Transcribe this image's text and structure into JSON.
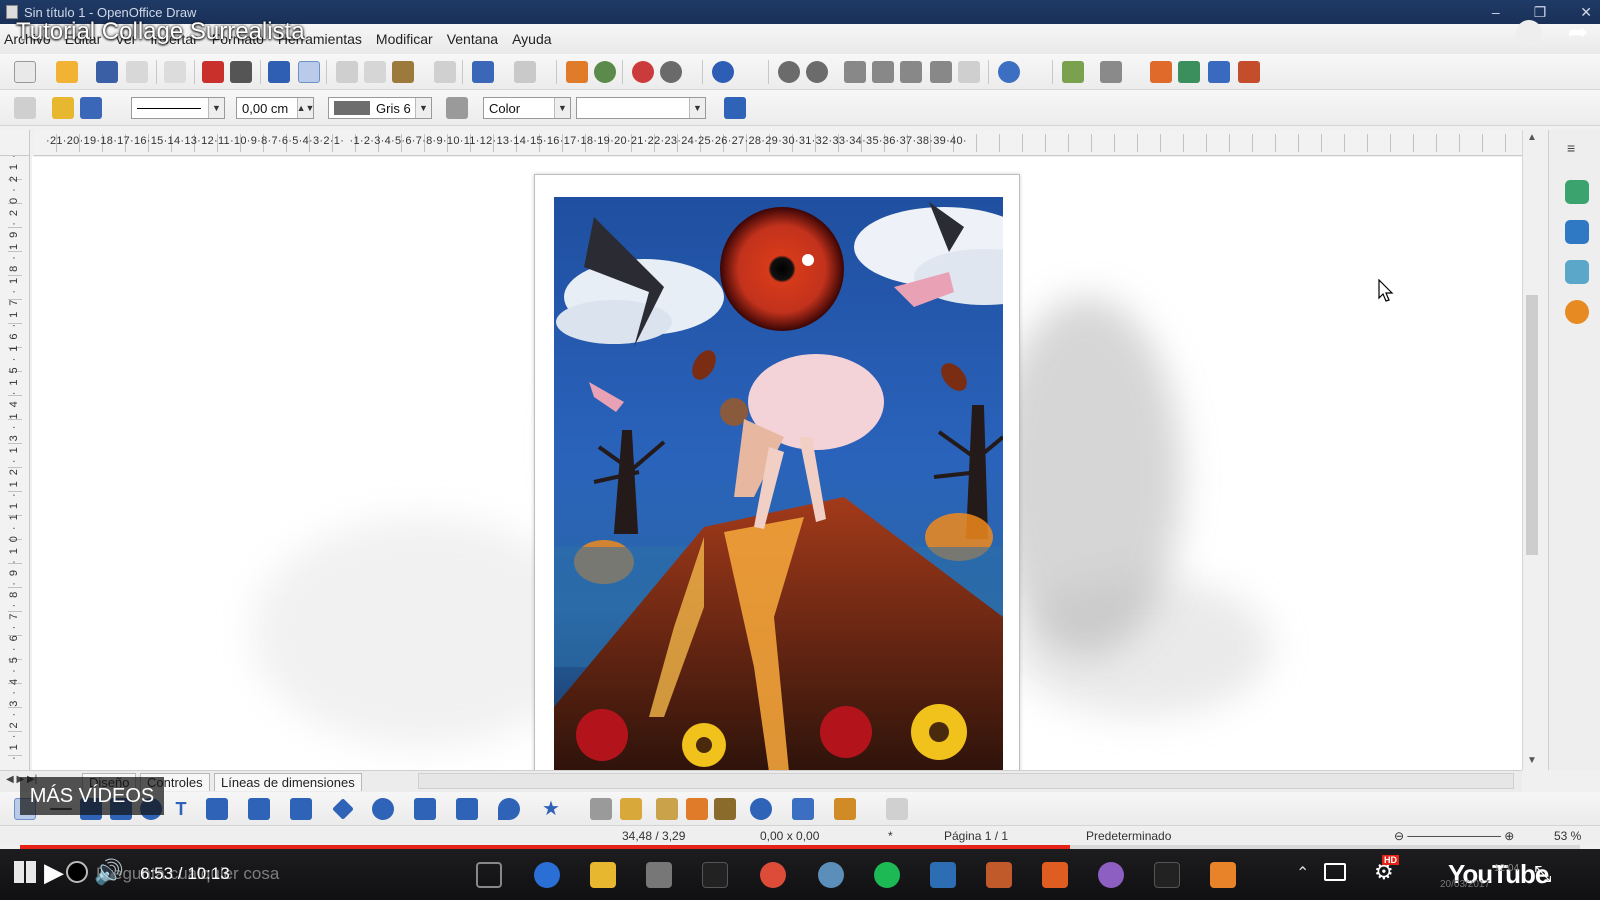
{
  "window": {
    "title": "Sin título 1 - OpenOffice Draw"
  },
  "video": {
    "title": "Tutorial Collage Surrealista",
    "more_videos": "MÁS VÍDEOS",
    "time": "6:53 / 10:13",
    "progress_fraction": 0.673,
    "logo": "YouTube"
  },
  "menu": [
    "Archivo",
    "Editar",
    "Ver",
    "Insertar",
    "Formato",
    "Herramientas",
    "Modificar",
    "Ventana",
    "Ayuda"
  ],
  "line_toolbar": {
    "line_width": "0,00 cm",
    "line_color": "Gris 6",
    "fill_mode": "Color",
    "fill_value": ""
  },
  "ruler": {
    "horizontal": "·21·20·19·18·17·16·15·14·13·12·11·10·9·8·7·6·5·4·3·2·1·  ·1·2·3·4·5·6·7·8·9·10·11·12·13·14·15·16·17·18·19·20·21·22·23·24·25·26·27·28·29·30·31·32·33·34·35·36·37·38·39·40·",
    "vertical": "·1·2·3·4·5·6·7·8·9·10·11·12·13·14·15·16·17·18·19·20·21·22·23·24"
  },
  "layer_tabs": [
    "Diseño",
    "Controles",
    "Líneas de dimensiones"
  ],
  "status": {
    "position": "34,48 / 3,29",
    "size": "0,00 x 0,00",
    "modified": "*",
    "page": "Página 1 / 1",
    "style": "Predeterminado",
    "zoom": "53 %"
  },
  "taskbar": {
    "search_placeholder": "Pregunta cualquier cosa",
    "clock_time": "12:04",
    "clock_date": "20/03/2017"
  },
  "colors": {
    "accent_progress": "#e62117",
    "title_bar": "#1f3a66",
    "sky": "#2a63bb"
  }
}
